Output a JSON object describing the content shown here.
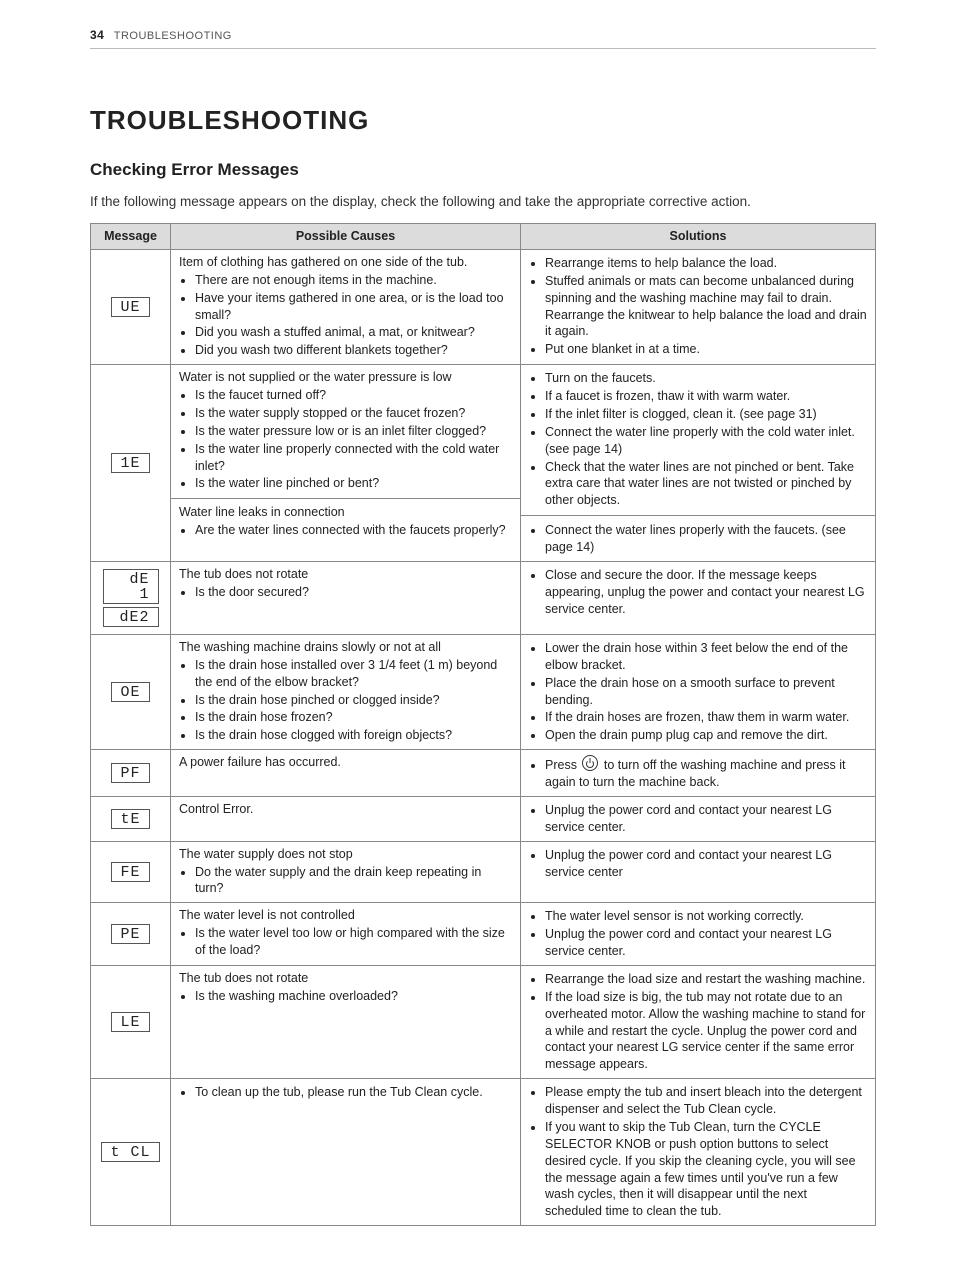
{
  "page_number": "34",
  "running_head": "TROUBLESHOOTING",
  "title": "TROUBLESHOOTING",
  "subtitle": "Checking Error Messages",
  "intro": "If the following message appears on the display, check the following and take the appropriate corrective action.",
  "headers": {
    "message": "Message",
    "causes": "Possible Causes",
    "solutions": "Solutions"
  },
  "rows": [
    {
      "codes": [
        "UE"
      ],
      "causes": [
        {
          "lead": "Item of clothing has gathered on one side of the tub.",
          "items": [
            "There are not enough items in the machine.",
            "Have your items gathered in one area, or is the load too small?",
            "Did you wash a stuffed animal, a mat, or knitwear?",
            "Did you wash two different blankets together?"
          ]
        }
      ],
      "solutions": [
        {
          "items": [
            "Rearrange items to help balance the load.",
            "Stuffed animals or mats can become unbalanced during spinning and the washing machine may fail to drain. Rearrange the knitwear to help balance the load and drain it again.",
            "Put one blanket in at a time."
          ]
        }
      ]
    },
    {
      "codes": [
        "IE"
      ],
      "codes_display": [
        "1E"
      ],
      "causes": [
        {
          "lead": "Water is not supplied or the water pressure is low",
          "items": [
            "Is the faucet turned off?",
            "Is the water supply stopped or the faucet frozen?",
            "Is the water pressure low or is an inlet filter clogged?",
            "Is the water line properly connected with the cold water inlet?",
            "Is the water line pinched or bent?"
          ]
        },
        {
          "lead": "Water line leaks in connection",
          "items": [
            "Are the water lines connected with the faucets properly?"
          ]
        }
      ],
      "solutions": [
        {
          "items": [
            "Turn on the faucets.",
            "If a faucet is frozen, thaw it with warm water.",
            "If the inlet filter is clogged, clean it. (see page 31)",
            "Connect the water line properly with the cold water inlet. (see page 14)",
            "Check that the water lines are not pinched or bent. Take extra care that water lines are not twisted or pinched by other objects."
          ]
        },
        {
          "items": [
            "Connect the water lines properly with the faucets. (see page 14)"
          ]
        }
      ]
    },
    {
      "codes": [
        "dE1",
        "dE2"
      ],
      "codes_display": [
        "dE 1",
        "dE2"
      ],
      "causes": [
        {
          "lead": "The tub does not rotate",
          "items": [
            "Is the door secured?"
          ]
        }
      ],
      "solutions": [
        {
          "items": [
            "Close and secure the door. If the message keeps appearing, unplug the power and contact your nearest LG service center."
          ]
        }
      ]
    },
    {
      "codes": [
        "OE"
      ],
      "causes": [
        {
          "lead": "The washing machine drains slowly or not at all",
          "items": [
            "Is the drain hose installed over 3 1/4 feet (1 m) beyond the end of the elbow bracket?",
            "Is the drain hose pinched or clogged inside?",
            "Is the drain hose frozen?",
            "Is the drain hose clogged with foreign objects?"
          ]
        }
      ],
      "solutions": [
        {
          "items": [
            "Lower the drain hose within 3 feet below the end of the elbow bracket.",
            "Place the drain hose on a smooth surface to prevent bending.",
            "If the drain hoses are frozen, thaw them in warm water.",
            "Open the drain pump plug cap and remove the dirt."
          ]
        }
      ]
    },
    {
      "codes": [
        "PF"
      ],
      "causes": [
        {
          "lead": "A power failure has occurred."
        }
      ],
      "solutions": [
        {
          "items_html": [
            "Press <span class='pwr' data-name='power-icon' data-interactable='false'></span> to turn off the washing machine and press it again to turn the machine back."
          ]
        }
      ]
    },
    {
      "codes": [
        "tE"
      ],
      "causes": [
        {
          "lead": "Control Error."
        }
      ],
      "solutions": [
        {
          "items": [
            "Unplug the power cord and contact your nearest LG service center."
          ]
        }
      ]
    },
    {
      "codes": [
        "FE"
      ],
      "causes": [
        {
          "lead": "The water supply does not stop",
          "items": [
            "Do the water supply and the drain keep repeating in turn?"
          ]
        }
      ],
      "solutions": [
        {
          "items": [
            "Unplug the power cord and contact your nearest LG service center"
          ]
        }
      ]
    },
    {
      "codes": [
        "PE"
      ],
      "causes": [
        {
          "lead": "The water level is not controlled",
          "items": [
            "Is the water level too low or high compared with the size of the load?"
          ]
        }
      ],
      "solutions": [
        {
          "items": [
            "The water level sensor is not working correctly.",
            "Unplug the power cord and contact your nearest LG service center."
          ]
        }
      ]
    },
    {
      "codes": [
        "LE"
      ],
      "causes": [
        {
          "lead": "The tub does not rotate",
          "items": [
            "Is the washing machine overloaded?"
          ]
        }
      ],
      "solutions": [
        {
          "items": [
            "Rearrange the load size and restart the washing machine.",
            "If the load size is big, the tub may not rotate due to an overheated motor. Allow the washing machine to stand for a while and restart the cycle. Unplug the power cord and contact your nearest LG service center if the same error message appears."
          ]
        }
      ]
    },
    {
      "codes": [
        "tCL"
      ],
      "codes_display": [
        "t CL"
      ],
      "causes": [
        {
          "items": [
            "To clean up the tub, please run the Tub Clean cycle."
          ]
        }
      ],
      "solutions": [
        {
          "items": [
            "Please empty the tub and insert bleach into the detergent dispenser and select the Tub Clean cycle.",
            "If you want to skip the Tub Clean, turn the CYCLE SELECTOR KNOB or push option buttons to select desired cycle. If you skip the cleaning cycle, you will see the message again a few times until you've run a few wash cycles, then it will disappear until the next scheduled time to clean the tub."
          ]
        }
      ]
    }
  ]
}
